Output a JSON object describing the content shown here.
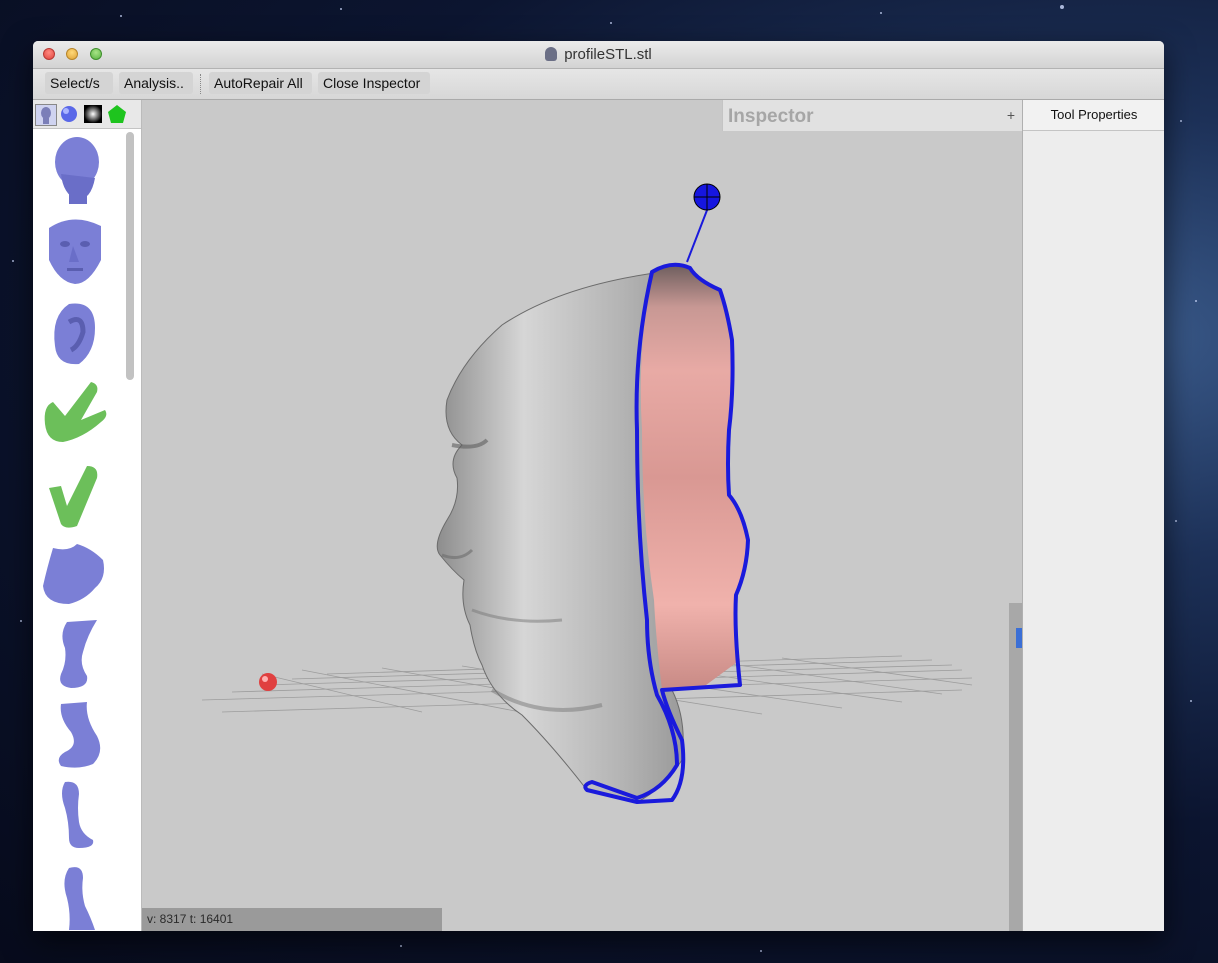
{
  "window": {
    "title": "profileSTL.stl"
  },
  "toolbar": {
    "select_label": "Select/s",
    "analysis_label": "Analysis..",
    "autorepair_label": "AutoRepair All",
    "close_inspector_label": "Close Inspector"
  },
  "library": {
    "tabs": [
      "head-model-icon",
      "sphere-icon",
      "gradient-icon",
      "pentagon-icon"
    ],
    "items": [
      "head",
      "face",
      "ear",
      "hand-peace",
      "hand-check",
      "foot",
      "leg",
      "leg-bent",
      "leg-thin",
      "leg-partial"
    ]
  },
  "inspector": {
    "title": "Inspector",
    "add_label": "+"
  },
  "tool_properties": {
    "title": "Tool Properties"
  },
  "status": {
    "text": "v: 8317 t: 16401"
  },
  "colors": {
    "mesh": "#c8c8c8",
    "cut_surface": "#e8a6a2",
    "selection": "#1a1adc",
    "library_blue": "#7b7fd6",
    "library_green": "#6cbf5a"
  }
}
